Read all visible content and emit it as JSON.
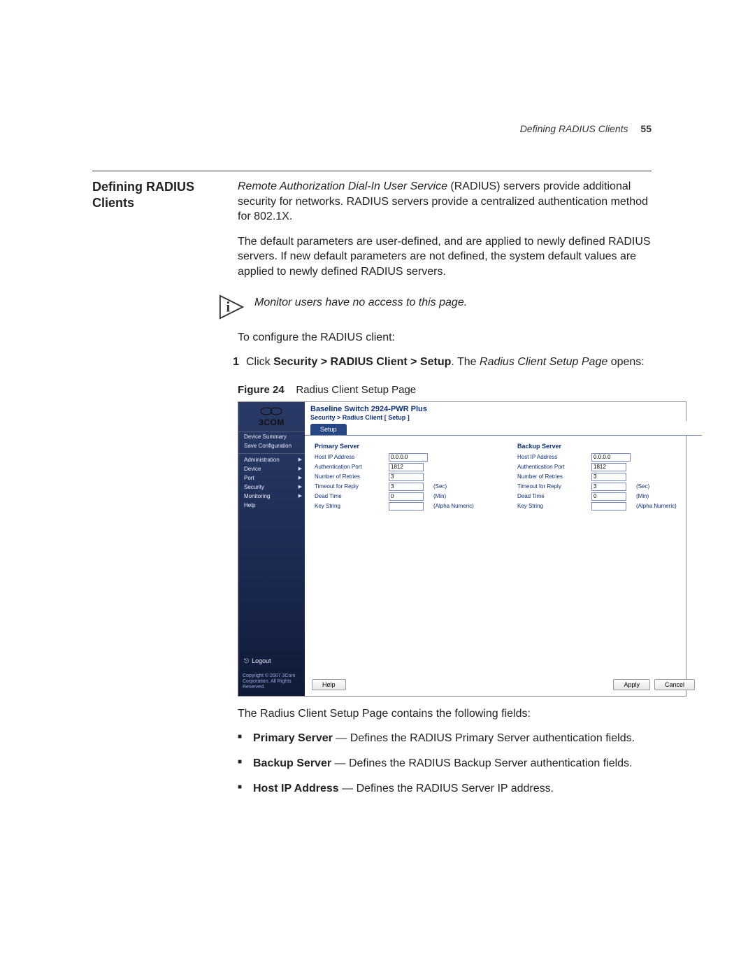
{
  "running_head": {
    "label": "Defining RADIUS Clients",
    "page": "55"
  },
  "section_title": "Defining RADIUS Clients",
  "para1_lead_em": "Remote Authorization Dial-In User Service",
  "para1_rest": " (RADIUS) servers provide additional security for networks. RADIUS servers provide a centralized authentication method for 802.1X.",
  "para2": "The default parameters are user-defined, and are applied to newly defined RADIUS servers. If new default parameters are not defined, the system default values are applied to newly defined RADIUS servers.",
  "info_note": "Monitor users have no access to this page.",
  "para3": "To configure the RADIUS client:",
  "step1_num": "1",
  "step1_pre": "Click ",
  "step1_bold": "Security > RADIUS Client > Setup",
  "step1_mid": ". The ",
  "step1_em": "Radius Client Setup Page",
  "step1_post": " opens:",
  "figure_label": "Figure 24",
  "figure_caption": "Radius Client Setup Page",
  "shot": {
    "brand": "3COM",
    "product": "Baseline Switch 2924-PWR Plus",
    "breadcrumb": "Security > Radius Client [ Setup ]",
    "tab": "Setup",
    "nav_top": [
      "Device Summary",
      "Save Configuration"
    ],
    "nav_main": [
      "Administration",
      "Device",
      "Port",
      "Security",
      "Monitoring",
      "Help"
    ],
    "logout": "Logout",
    "copyright": "Copyright © 2007 3Com Corporation. All Rights Reserved.",
    "primary_title": "Primary Server",
    "backup_title": "Backup Server",
    "rows": [
      {
        "label": "Host IP Address",
        "unit": "",
        "p_val": "0.0.0.0",
        "b_val": "0.0.0.0"
      },
      {
        "label": "Authentication Port",
        "unit": "",
        "p_val": "1812",
        "b_val": "1812"
      },
      {
        "label": "Number of Retries",
        "unit": "",
        "p_val": "3",
        "b_val": "3"
      },
      {
        "label": "Timeout for Reply",
        "unit": "(Sec)",
        "p_val": "3",
        "b_val": "3"
      },
      {
        "label": "Dead Time",
        "unit": "(Min)",
        "p_val": "0",
        "b_val": "0"
      },
      {
        "label": "Key String",
        "unit": "(Alpha Numeric)",
        "p_val": "",
        "b_val": ""
      }
    ],
    "btn_help": "Help",
    "btn_apply": "Apply",
    "btn_cancel": "Cancel"
  },
  "after_fig_lead": "The ",
  "after_fig_em": "Radius Client Setup Page",
  "after_fig_tail": " contains the following fields:",
  "bullets": {
    "b1_bold": "Primary Server",
    "b1_rest": " — Defines the RADIUS Primary Server authentication fields.",
    "b2_bold": "Backup Server",
    "b2_rest": " — Defines the RADIUS Backup Server authentication fields.",
    "b3_bold": "Host IP Address",
    "b3_rest": " — Defines the RADIUS Server IP address."
  }
}
